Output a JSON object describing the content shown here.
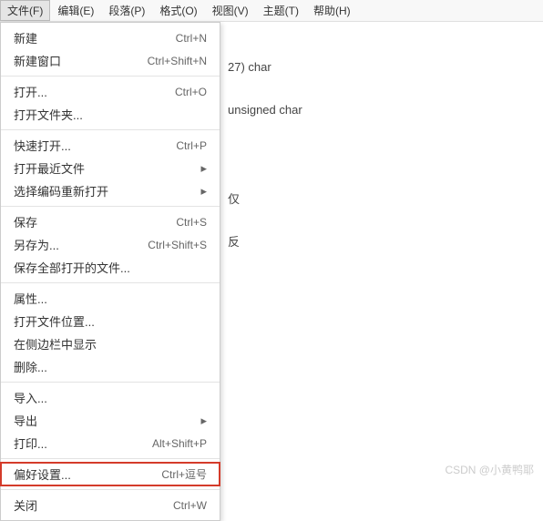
{
  "menubar": [
    {
      "label": "文件(F)"
    },
    {
      "label": "编辑(E)"
    },
    {
      "label": "段落(P)"
    },
    {
      "label": "格式(O)"
    },
    {
      "label": "视图(V)"
    },
    {
      "label": "主题(T)"
    },
    {
      "label": "帮助(H)"
    }
  ],
  "menu": [
    {
      "label": "新建",
      "shortcut": "Ctrl+N"
    },
    {
      "label": "新建窗口",
      "shortcut": "Ctrl+Shift+N"
    },
    {
      "sep": true
    },
    {
      "label": "打开...",
      "shortcut": "Ctrl+O"
    },
    {
      "label": "打开文件夹..."
    },
    {
      "sep": true
    },
    {
      "label": "快速打开...",
      "shortcut": "Ctrl+P"
    },
    {
      "label": "打开最近文件",
      "submenu": true
    },
    {
      "label": "选择编码重新打开",
      "submenu": true
    },
    {
      "sep": true
    },
    {
      "label": "保存",
      "shortcut": "Ctrl+S"
    },
    {
      "label": "另存为...",
      "shortcut": "Ctrl+Shift+S"
    },
    {
      "label": "保存全部打开的文件..."
    },
    {
      "sep": true
    },
    {
      "label": "属性..."
    },
    {
      "label": "打开文件位置..."
    },
    {
      "label": "在侧边栏中显示"
    },
    {
      "label": "删除..."
    },
    {
      "sep": true
    },
    {
      "label": "导入..."
    },
    {
      "label": "导出",
      "submenu": true
    },
    {
      "label": "打印...",
      "shortcut": "Alt+Shift+P"
    },
    {
      "sep": true
    },
    {
      "label": "偏好设置...",
      "shortcut": "Ctrl+逗号",
      "hl": true
    },
    {
      "sep": true
    },
    {
      "label": "关闭",
      "shortcut": "Ctrl+W"
    }
  ],
  "bg": {
    "l1": "27)    char",
    "l2": "unsigned char",
    "l3": "仅",
    "l4": "反"
  },
  "watermark": "CSDN @小黄鸭耶"
}
